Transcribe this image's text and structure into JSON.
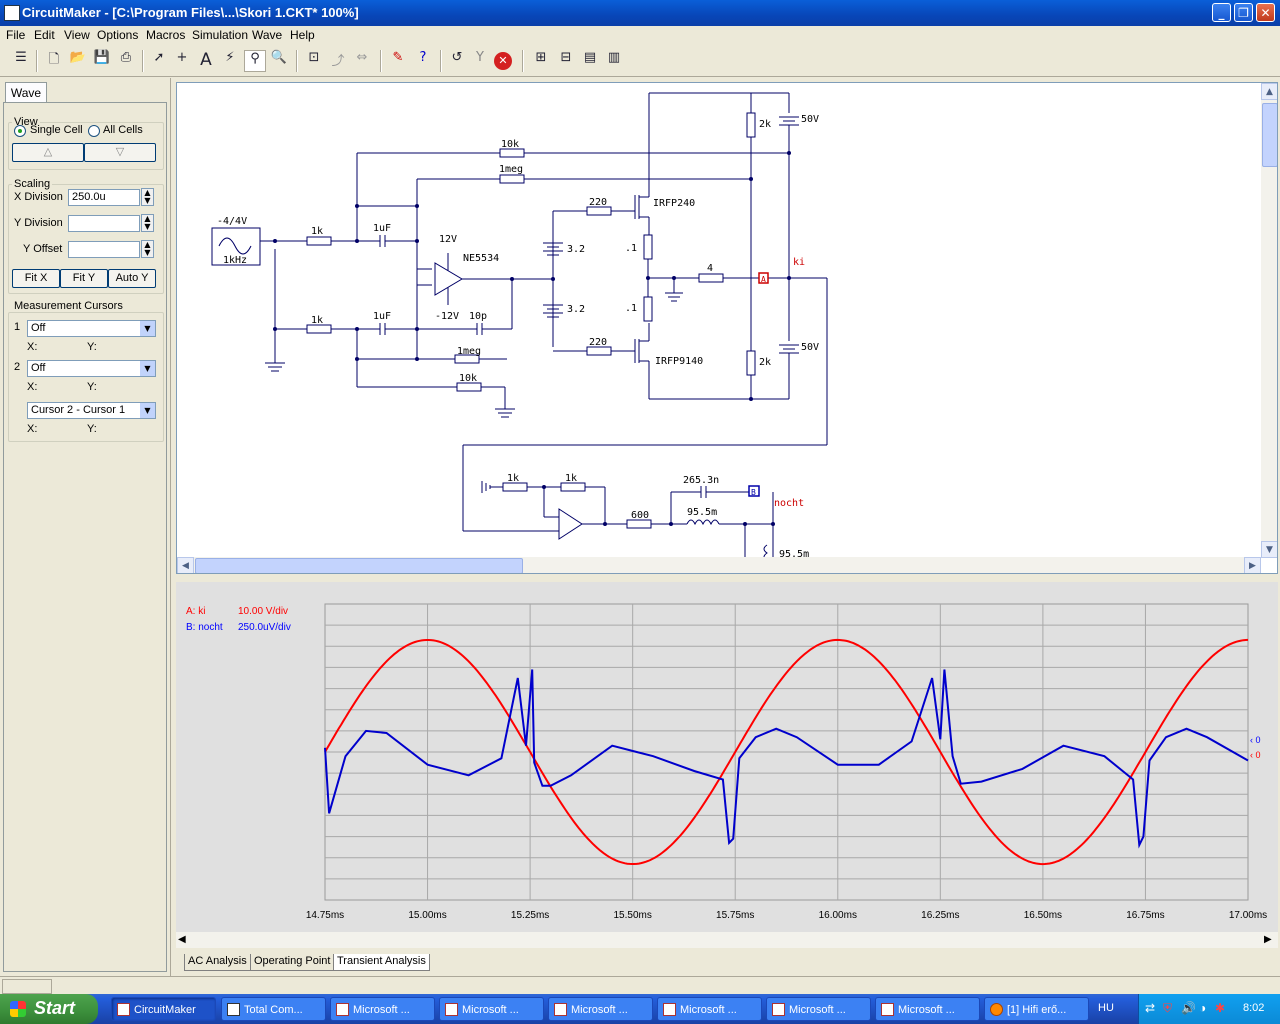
{
  "window": {
    "title": "CircuitMaker - [C:\\Program Files\\...\\Skori 1.CKT* 100%]",
    "minimize": "_",
    "maximize": "❐",
    "close": "✕"
  },
  "menu": [
    "File",
    "Edit",
    "View",
    "Options",
    "Macros",
    "Simulation",
    "Wave",
    "Help"
  ],
  "left_panel": {
    "tab": "Wave",
    "view_group": "View",
    "single_cell": "Single Cell",
    "all_cells": "All Cells",
    "up_arrow": "△",
    "down_arrow": "▽",
    "scaling_group": "Scaling",
    "x_division_label": "X Division",
    "x_division_value": "250.0u",
    "y_division_label": "Y Division",
    "y_division_value": "",
    "y_offset_label": "Y Offset",
    "y_offset_value": "",
    "fit_x": "Fit X",
    "fit_y": "Fit Y",
    "auto_y": "Auto Y",
    "cursors_group": "Measurement Cursors",
    "cursor1_num": "1",
    "cursor1_value": "Off",
    "cursor2_num": "2",
    "cursor2_value": "Off",
    "x_label": "X:",
    "y_label": "Y:",
    "cursor_diff_value": "Cursor 2 - Cursor 1"
  },
  "schematic": {
    "labels": {
      "gen_range": "-4/4V",
      "gen_freq": "1kHz",
      "r_1k_a": "1k",
      "r_1k_b": "1k",
      "c_1uf_a": "1uF",
      "c_1uf_b": "1uF",
      "r_10k_top": "10k",
      "r_1meg_top": "1meg",
      "r_1meg_bot": "1meg",
      "r_10k_bot": "10k",
      "opamp": "NE5534",
      "v_pos": "12V",
      "v_neg": "-12V",
      "c_10p": "10p",
      "bat_a": "3.2",
      "bat_b": "3.2",
      "r_220_a": "220",
      "r_220_b": "220",
      "q1": "IRFP240",
      "q2": "IRFP9140",
      "r_01_a": ".1",
      "r_01_b": ".1",
      "r_4": "4",
      "r_2k_a": "2k",
      "r_2k_b": "2k",
      "v50_a": "50V",
      "v50_b": "50V",
      "probe_a": "A",
      "net_ki": "ki",
      "r_1k_c": "1k",
      "r_1k_d": "1k",
      "r_600": "600",
      "c_265": "265.3n",
      "l_95": "95.5m",
      "l_95_b": "95.5m",
      "probe_b": "B",
      "net_nocht": "nocht"
    }
  },
  "waveform": {
    "legend": [
      {
        "name": "A: ki",
        "scale": "10.00 V/div",
        "color": "#ff0000"
      },
      {
        "name": "B: nocht",
        "scale": "250.0uV/div",
        "color": "#0000ff"
      }
    ],
    "marker_b": "‹ 0",
    "marker_a": "‹ 0"
  },
  "chart_data": {
    "type": "line",
    "x_unit": "ms",
    "xlim": [
      14.75,
      17.0
    ],
    "x_ticks": [
      "14.75ms",
      "15.00ms",
      "15.25ms",
      "15.50ms",
      "15.75ms",
      "16.00ms",
      "16.25ms",
      "16.50ms",
      "16.75ms",
      "17.00ms"
    ],
    "grid": true,
    "series": [
      {
        "name": "A: ki",
        "color": "#ff0000",
        "scale": "10.00 V/div",
        "kind": "sine",
        "amplitude_div": 5.3,
        "period_ms": 1.0,
        "peak_at_ms": 15.0
      },
      {
        "name": "B: nocht",
        "color": "#0000ff",
        "scale": "250.0uV/div",
        "x": [
          14.75,
          14.76,
          14.8,
          14.85,
          14.9,
          15.0,
          15.1,
          15.18,
          15.22,
          15.24,
          15.255,
          15.26,
          15.28,
          15.3,
          15.35,
          15.45,
          15.55,
          15.65,
          15.72,
          15.735,
          15.745,
          15.76,
          15.8,
          15.85,
          15.9,
          16.0,
          16.1,
          16.18,
          16.23,
          16.25,
          16.26,
          16.28,
          16.3,
          16.35,
          16.45,
          16.55,
          16.65,
          16.72,
          16.735,
          16.745,
          16.76,
          16.8,
          16.85,
          16.9,
          17.0
        ],
        "y": [
          0.2,
          -2.9,
          -0.2,
          1.0,
          0.9,
          -0.6,
          -1.1,
          -0.3,
          3.5,
          0.3,
          3.9,
          -0.5,
          -1.6,
          -1.6,
          -1.1,
          0.3,
          -0.2,
          -0.9,
          -1.3,
          -4.3,
          -4.1,
          -0.3,
          0.7,
          1.1,
          0.7,
          -0.6,
          -0.6,
          0.5,
          3.5,
          0.6,
          3.9,
          -0.2,
          -1.5,
          -1.4,
          -0.8,
          0.3,
          -0.2,
          -1.3,
          -4.4,
          -4.0,
          -0.4,
          0.7,
          1.1,
          0.7,
          -0.4
        ]
      }
    ]
  },
  "tabs": [
    "AC Analysis",
    "Operating Point",
    "Transient Analysis"
  ],
  "taskbar": {
    "start": "Start",
    "items": [
      "CircuitMaker",
      "Total Com...",
      "Microsoft ...",
      "Microsoft ...",
      "Microsoft ...",
      "Microsoft ...",
      "Microsoft ...",
      "Microsoft ...",
      "[1] Hifi erő..."
    ],
    "lang": "HU",
    "clock": "8:02"
  }
}
